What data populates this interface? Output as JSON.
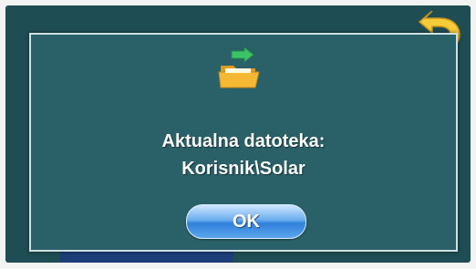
{
  "dialog": {
    "message_line1": "Aktualna datoteka:",
    "message_line2": "Korisnik\\Solar",
    "ok_label": "OK"
  },
  "icons": {
    "folder": "folder-with-green-arrow-icon",
    "back": "back-arrow-icon"
  },
  "colors": {
    "screen_bg": "#1e4d53",
    "dialog_bg": "#2a6168",
    "button_blue": "#2f80da",
    "folder_yellow": "#f5b835",
    "arrow_green": "#3cc36a"
  }
}
